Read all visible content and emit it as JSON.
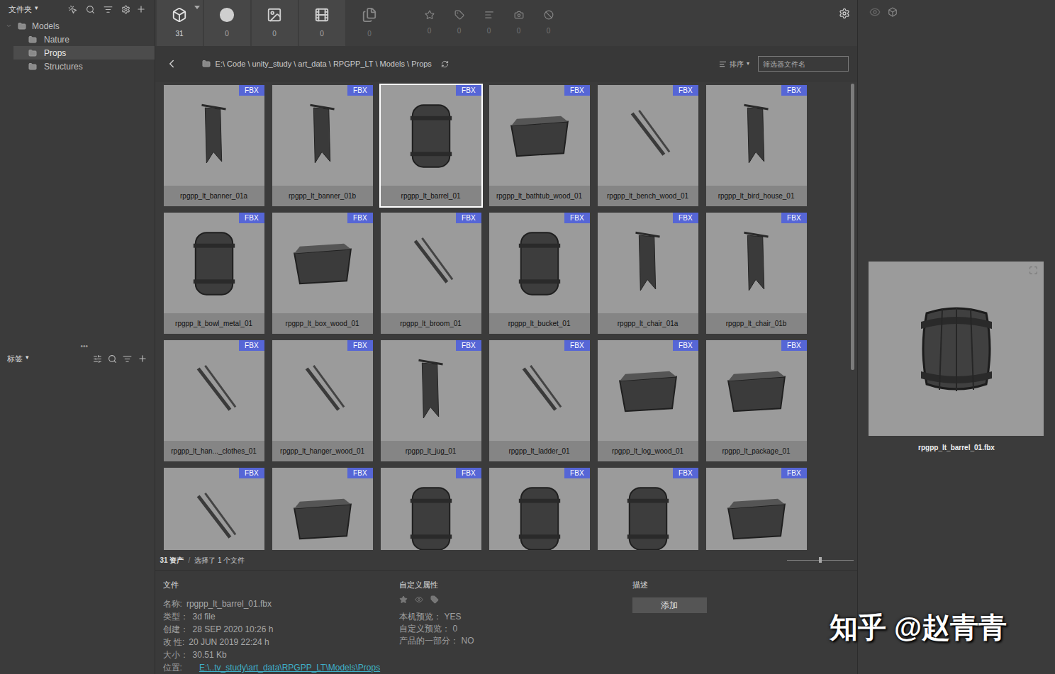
{
  "left_panel": {
    "folders_header": "文件夹",
    "folders_caret": "▾",
    "tree": [
      {
        "label": "Models",
        "depth": 0,
        "expanded": true,
        "selected": false
      },
      {
        "label": "Nature",
        "depth": 1,
        "expanded": false,
        "selected": false
      },
      {
        "label": "Props",
        "depth": 1,
        "expanded": false,
        "selected": true
      },
      {
        "label": "Structures",
        "depth": 1,
        "expanded": false,
        "selected": false
      }
    ],
    "splitter": "•••",
    "tags_header": "标签",
    "tags_caret": "▾"
  },
  "toolbar": {
    "tabs": [
      {
        "count": "31",
        "selected": true,
        "enabled": true
      },
      {
        "count": "0",
        "selected": false,
        "enabled": true
      },
      {
        "count": "0",
        "selected": false,
        "enabled": true
      },
      {
        "count": "0",
        "selected": false,
        "enabled": true
      },
      {
        "count": "0",
        "selected": false,
        "enabled": false
      }
    ],
    "filters": [
      {
        "count": "0"
      },
      {
        "count": "0"
      },
      {
        "count": "0"
      },
      {
        "count": "0"
      },
      {
        "count": "0"
      }
    ]
  },
  "path_bar": {
    "path": "E:\\ Code \\ unity_study \\ art_data \\ RPGPP_LT \\ Models \\ Props",
    "sort": "排序",
    "sort_caret": "▾",
    "filter_placeholder": "筛选器文件名"
  },
  "assets": [
    {
      "name": "rpgpp_lt_banner_01a",
      "badge": "FBX",
      "selected": false
    },
    {
      "name": "rpgpp_lt_banner_01b",
      "badge": "FBX",
      "selected": false
    },
    {
      "name": "rpgpp_lt_barrel_01",
      "badge": "FBX",
      "selected": true
    },
    {
      "name": "rpgpp_lt_bathtub_wood_01",
      "badge": "FBX",
      "selected": false
    },
    {
      "name": "rpgpp_lt_bench_wood_01",
      "badge": "FBX",
      "selected": false
    },
    {
      "name": "rpgpp_lt_bird_house_01",
      "badge": "FBX",
      "selected": false
    },
    {
      "name": "rpgpp_lt_bowl_metal_01",
      "badge": "FBX",
      "selected": false
    },
    {
      "name": "rpgpp_lt_box_wood_01",
      "badge": "FBX",
      "selected": false
    },
    {
      "name": "rpgpp_lt_broom_01",
      "badge": "FBX",
      "selected": false
    },
    {
      "name": "rpgpp_lt_bucket_01",
      "badge": "FBX",
      "selected": false
    },
    {
      "name": "rpgpp_lt_chair_01a",
      "badge": "FBX",
      "selected": false
    },
    {
      "name": "rpgpp_lt_chair_01b",
      "badge": "FBX",
      "selected": false
    },
    {
      "name": "rpgpp_lt_han..._clothes_01",
      "badge": "FBX",
      "selected": false
    },
    {
      "name": "rpgpp_lt_hanger_wood_01",
      "badge": "FBX",
      "selected": false
    },
    {
      "name": "rpgpp_lt_jug_01",
      "badge": "FBX",
      "selected": false
    },
    {
      "name": "rpgpp_lt_ladder_01",
      "badge": "FBX",
      "selected": false
    },
    {
      "name": "rpgpp_lt_log_wood_01",
      "badge": "FBX",
      "selected": false
    },
    {
      "name": "rpgpp_lt_package_01",
      "badge": "FBX",
      "selected": false
    },
    {
      "badge": "FBX",
      "selected": false
    },
    {
      "badge": "FBX",
      "selected": false
    },
    {
      "badge": "FBX",
      "selected": false
    },
    {
      "badge": "FBX",
      "selected": false
    },
    {
      "badge": "FBX",
      "selected": false
    },
    {
      "badge": "FBX",
      "selected": false
    }
  ],
  "status_bar": {
    "count": "31 资产",
    "separator": "/",
    "selection": "选择了 1 个文件",
    "zoom_level": 0.5
  },
  "info": {
    "file_header": "文件",
    "file_fields": [
      {
        "label": "名称:",
        "value": "rpgpp_lt_barrel_01.fbx"
      },
      {
        "label": "类型：",
        "value": "3d file"
      },
      {
        "label": "创建：",
        "value": "28 SEP 2020 10:26 h"
      },
      {
        "label": "改 性:",
        "value": "20 JUN 2019 22:24 h"
      },
      {
        "label": "大小：",
        "value": "30.51 Kb"
      }
    ],
    "location": {
      "label": "位置:",
      "value": "E:\\..tv_study\\art_data\\RPGPP_LT\\Models\\Props"
    },
    "custom_header": "自定义属性",
    "custom_fields": [
      {
        "label": "本机预览：",
        "value": "YES"
      },
      {
        "label": "自定义预览：",
        "value": "0"
      },
      {
        "label": "产品的一部分：",
        "value": "NO"
      }
    ],
    "desc_header": "描述",
    "add_button": "添加"
  },
  "preview": {
    "caption": "rpgpp_lt_barrel_01.fbx"
  },
  "watermark": "知乎 @赵青青"
}
